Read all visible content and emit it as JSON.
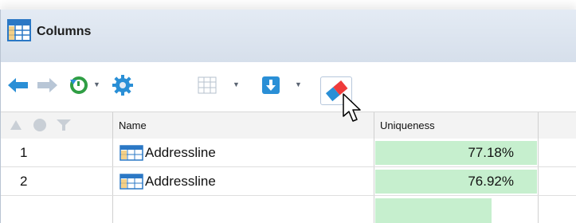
{
  "panel": {
    "title": "Columns"
  },
  "toolbar": {
    "items": [
      "arrow-left-icon",
      "arrow-right-icon",
      "refresh-icon",
      "gear-icon",
      "table-view-icon",
      "download-icon",
      "eraser-icon"
    ]
  },
  "grid": {
    "columns": [
      "Name",
      "Uniqueness"
    ],
    "rows": [
      {
        "index": "1",
        "name": "Addressline",
        "uniqueness": "77.18%",
        "uniqueness_fraction": 0.7718
      },
      {
        "index": "2",
        "name": "Addressline",
        "uniqueness": "76.92%",
        "uniqueness_fraction": 0.7692
      }
    ]
  },
  "colors": {
    "header_bg": "#dbe3ee",
    "accent_blue": "#2a8fd6",
    "uniq_green": "#c6efce",
    "clock_green": "#2f9e44"
  }
}
